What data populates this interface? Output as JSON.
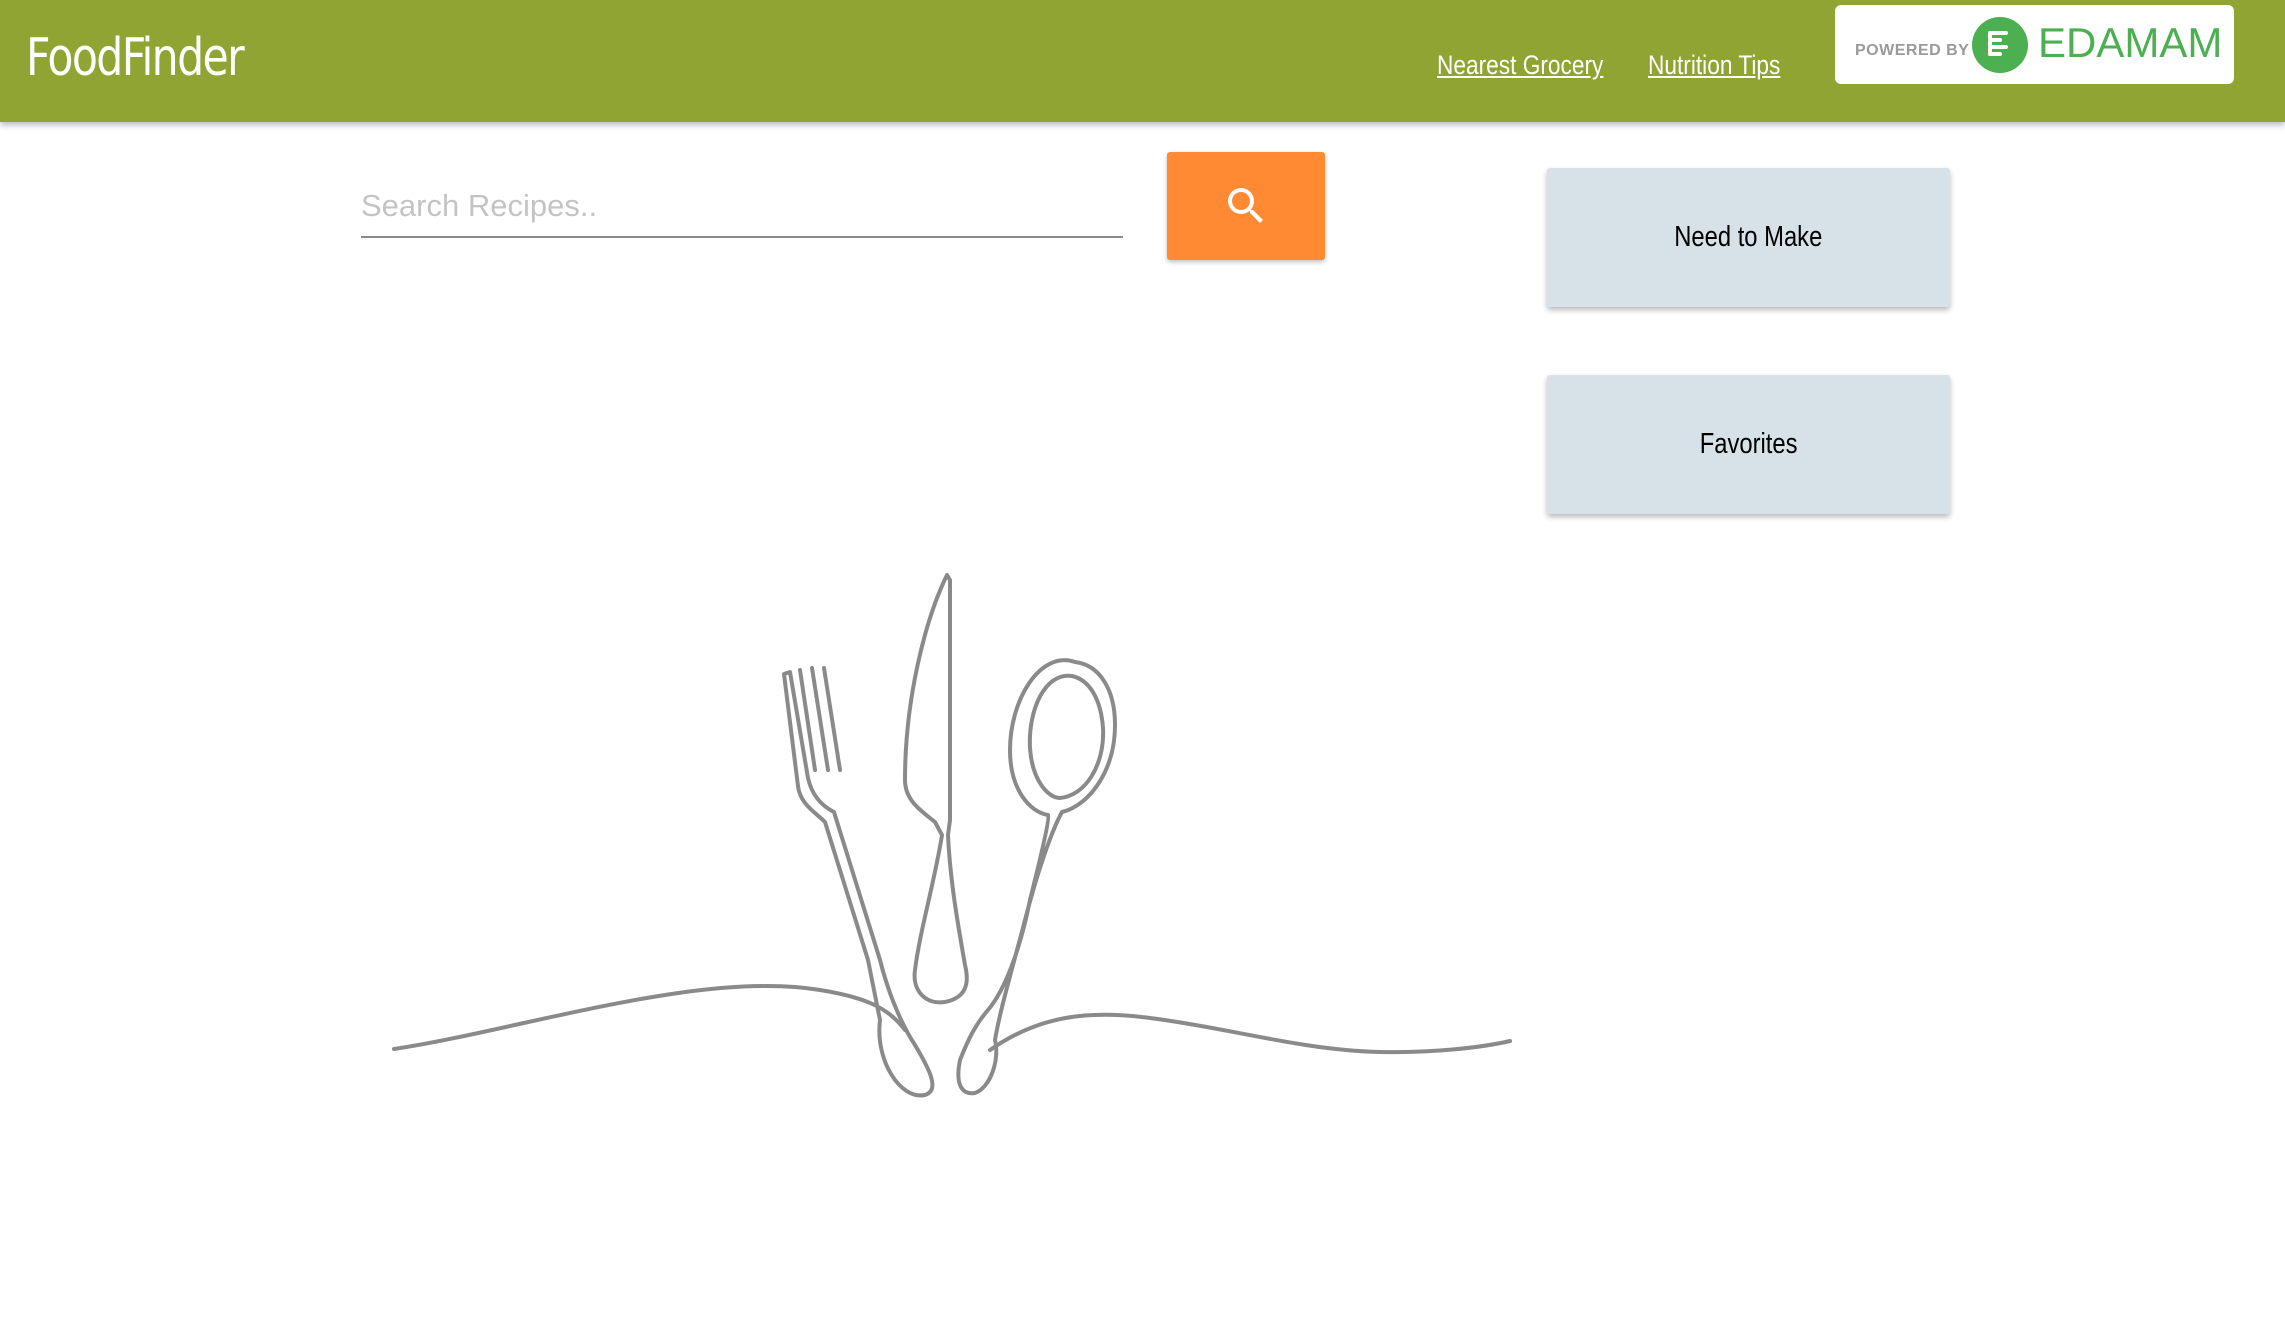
{
  "navbar": {
    "brand": "FoodFinder",
    "links": [
      "Nearest Grocery",
      "Nutrition Tips"
    ],
    "attribution": {
      "powered_by": "POWERED BY",
      "name": "EDAMAM"
    }
  },
  "search": {
    "placeholder": "Search Recipes..",
    "value": "",
    "button_icon": "search-icon"
  },
  "sidebar": {
    "buttons": [
      "Need to Make",
      "Favorites"
    ]
  },
  "colors": {
    "navbar": "#8fa432",
    "search_button": "#ff8a33",
    "side_button": "#d6e1e8",
    "edamam_green": "#4caf50",
    "illustration_stroke": "#8a8a8a"
  },
  "illustration": {
    "icon": "cutlery-line-art-icon"
  }
}
